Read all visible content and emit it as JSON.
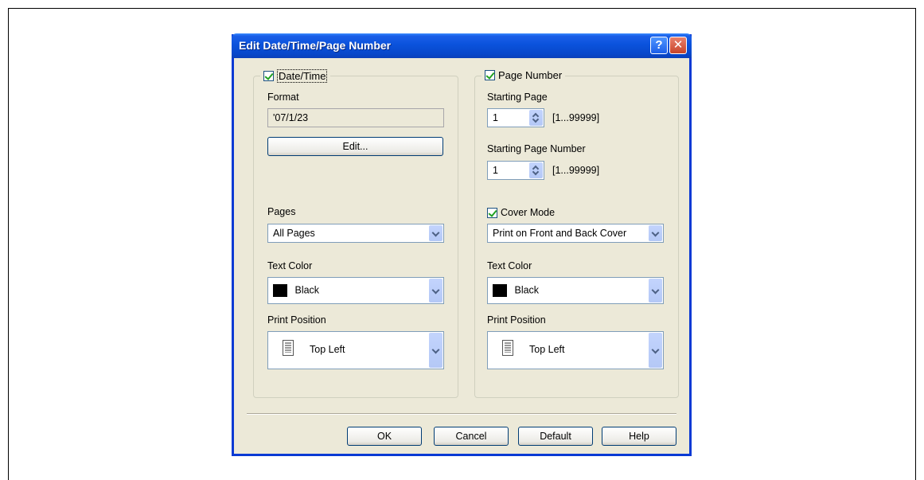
{
  "dialog": {
    "title": "Edit Date/Time/Page Number",
    "help_btn": "?",
    "close_btn": "✕"
  },
  "left": {
    "checkbox_label": "Date/Time",
    "format_label": "Format",
    "format_value": "'07/1/23",
    "edit_button": "Edit...",
    "pages_label": "Pages",
    "pages_value": "All Pages",
    "text_color_label": "Text Color",
    "text_color_value": "Black",
    "print_position_label": "Print Position",
    "print_position_value": "Top Left"
  },
  "right": {
    "checkbox_label": "Page Number",
    "starting_page_label": "Starting Page",
    "starting_page_value": "1",
    "starting_page_range": "[1...99999]",
    "starting_page_number_label": "Starting Page Number",
    "starting_page_number_value": "1",
    "starting_page_number_range": "[1...99999]",
    "cover_mode_label": "Cover Mode",
    "cover_mode_value": "Print on Front and Back Cover",
    "text_color_label": "Text Color",
    "text_color_value": "Black",
    "print_position_label": "Print Position",
    "print_position_value": "Top Left"
  },
  "buttons": {
    "ok": "OK",
    "cancel": "Cancel",
    "default": "Default",
    "help": "Help"
  },
  "colors": {
    "title_bar": "#0a52dc",
    "dialog_bg": "#ece9d8",
    "text_color_swatch": "#000000"
  }
}
